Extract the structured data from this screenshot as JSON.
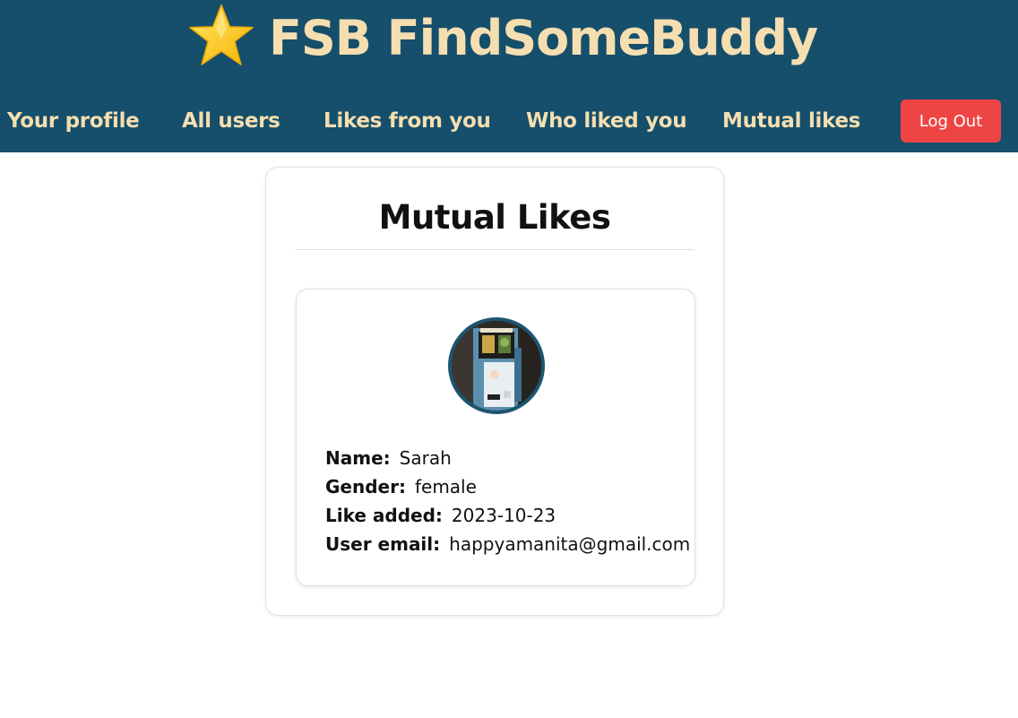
{
  "app": {
    "title": "FSB FindSomeBuddy",
    "star_icon": "star-icon",
    "colors": {
      "header_bg": "#154f6b",
      "header_text": "#f5deb0",
      "logout_bg": "#ef4444"
    }
  },
  "nav": {
    "items": [
      {
        "label": "Your profile"
      },
      {
        "label": "All users"
      },
      {
        "label": "Likes from you"
      },
      {
        "label": "Who liked you"
      },
      {
        "label": "Mutual likes"
      }
    ],
    "logout_label": "Log Out"
  },
  "page": {
    "title": "Mutual Likes"
  },
  "matches": [
    {
      "avatar": "user-avatar",
      "fields": [
        {
          "label": "Name:",
          "value": "Sarah"
        },
        {
          "label": "Gender:",
          "value": "female"
        },
        {
          "label": "Like added:",
          "value": "2023-10-23"
        },
        {
          "label": "User email:",
          "value": "happyamanita@gmail.com"
        }
      ]
    }
  ]
}
